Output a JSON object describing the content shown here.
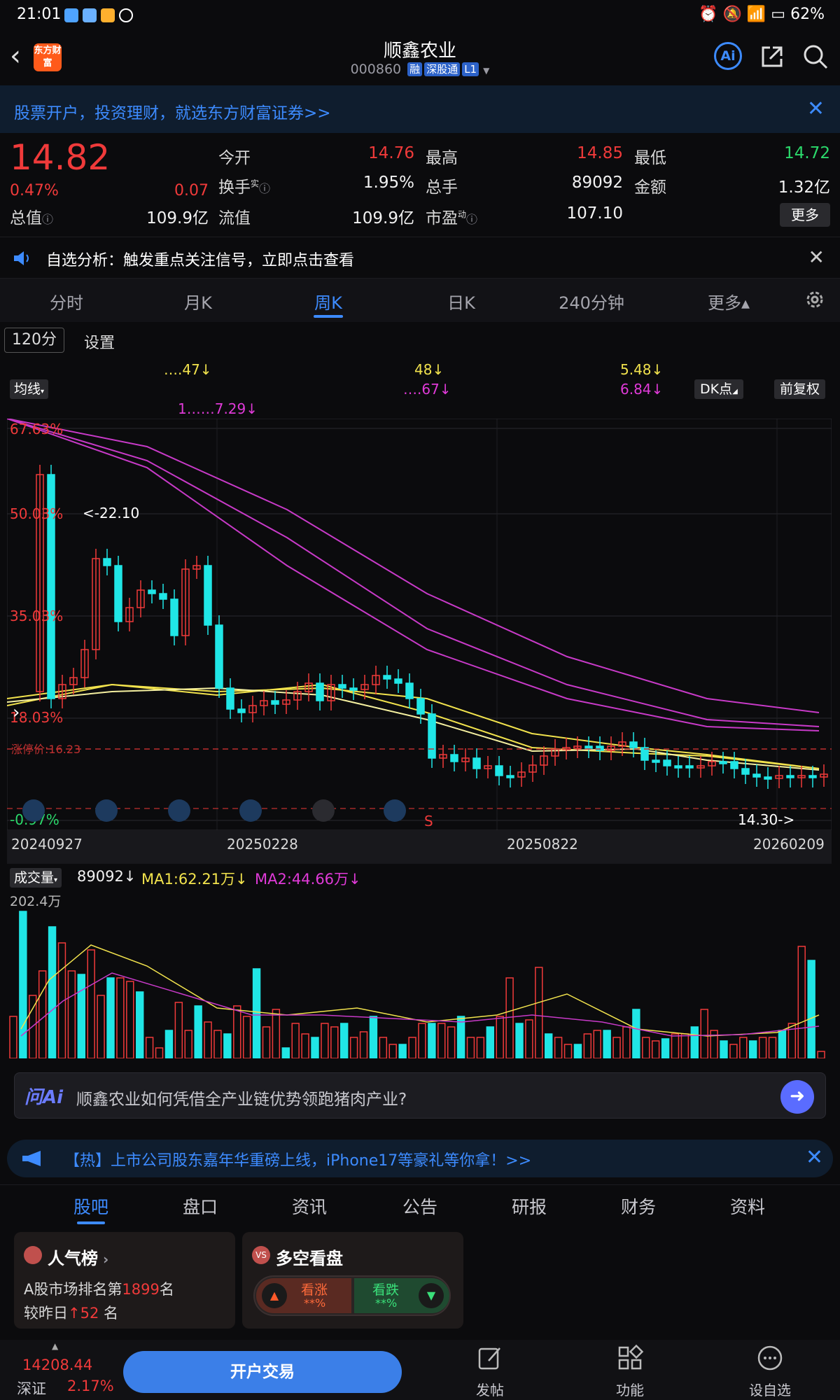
{
  "status_bar": {
    "time": "21:01",
    "battery": "62%"
  },
  "header": {
    "stock_name": "顺鑫农业",
    "stock_code": "000860",
    "tags": [
      "融",
      "深股通",
      "L1"
    ],
    "logo_text": "东方财富",
    "ai_label": "Ai"
  },
  "promo": {
    "text": "股票开户，投资理财，就选东方财富证券>>"
  },
  "quote": {
    "price": "14.82",
    "change_pct": "0.47%",
    "change_abs": "0.07",
    "open_label": "今开",
    "open": "14.76",
    "high_label": "最高",
    "high": "14.85",
    "low_label": "最低",
    "low": "14.72",
    "turnover_label": "换手",
    "turnover_sup": "实",
    "turnover": "1.95%",
    "volume_label": "总手",
    "volume": "89092",
    "amount_label": "金额",
    "amount": "1.32亿",
    "mktcap_label": "总值",
    "mktcap": "109.9亿",
    "float_label": "流值",
    "float": "109.9亿",
    "pe_label": "市盈",
    "pe_sup": "动",
    "pe": "107.10",
    "more_label": "更多"
  },
  "notice": {
    "text": "自选分析：触发重点关注信号，立即点击查看"
  },
  "period_tabs": [
    "分时",
    "月K",
    "周K",
    "日K",
    "240分钟",
    "更多▴"
  ],
  "toolbar": {
    "interval": "120分",
    "settings": "设置",
    "ma_select": "均线",
    "ma_values": [
      "….47↓",
      "48↓",
      "5.48↓",
      "….67↓",
      "6.84↓",
      "1……7.29↓"
    ],
    "dk": "DK点",
    "adj": "前复权"
  },
  "chart_data": {
    "type": "candlestick",
    "period": "weekly",
    "x_labels": [
      "20240927",
      "20250228",
      "20250822",
      "20260209"
    ],
    "y_axis_labels": [
      "67.63%",
      "50.03%",
      "35.03%",
      "18.03%",
      "-0.97%"
    ],
    "limit_up_label": "涨停价:16.23",
    "max_marker": "<-22.10",
    "min_marker": "14.30->",
    "signal_marker": "S",
    "ma_lines": [
      "MA5",
      "MA10",
      "MA20",
      "MA60",
      "MA120",
      "MA250"
    ]
  },
  "volume": {
    "select": "成交量",
    "value": "89092↓",
    "ma1": "MA1:62.21万↓",
    "ma2": "MA2:44.66万↓",
    "axis_max": "202.4万"
  },
  "ask_ai": {
    "logo": "问Ai",
    "text": "顺鑫农业如何凭借全产业链优势领跑猪肉产业?"
  },
  "hot_banner": {
    "text": "【热】上市公司股东嘉年华重磅上线，iPhone17等豪礼等你拿！>>"
  },
  "section_tabs": [
    "股吧",
    "盘口",
    "资讯",
    "公告",
    "研报",
    "财务",
    "资料"
  ],
  "popularity_card": {
    "title": "人气榜",
    "line1_prefix": "A股市场排名第",
    "rank": "1899",
    "line1_suffix": "名",
    "line2_prefix": "较昨日",
    "rank_change": "52",
    "line2_suffix": "名"
  },
  "longshort_card": {
    "title": "多空看盘",
    "bull_label": "看涨",
    "bull_value": "**%",
    "bear_label": "看跌",
    "bear_value": "**%"
  },
  "bottom_bar": {
    "index_value": "14208.44",
    "index_name": "深证",
    "index_pct": "2.17%",
    "trade_button": "开户交易",
    "post": "发帖",
    "functions": "功能",
    "watchlist": "设自选"
  }
}
